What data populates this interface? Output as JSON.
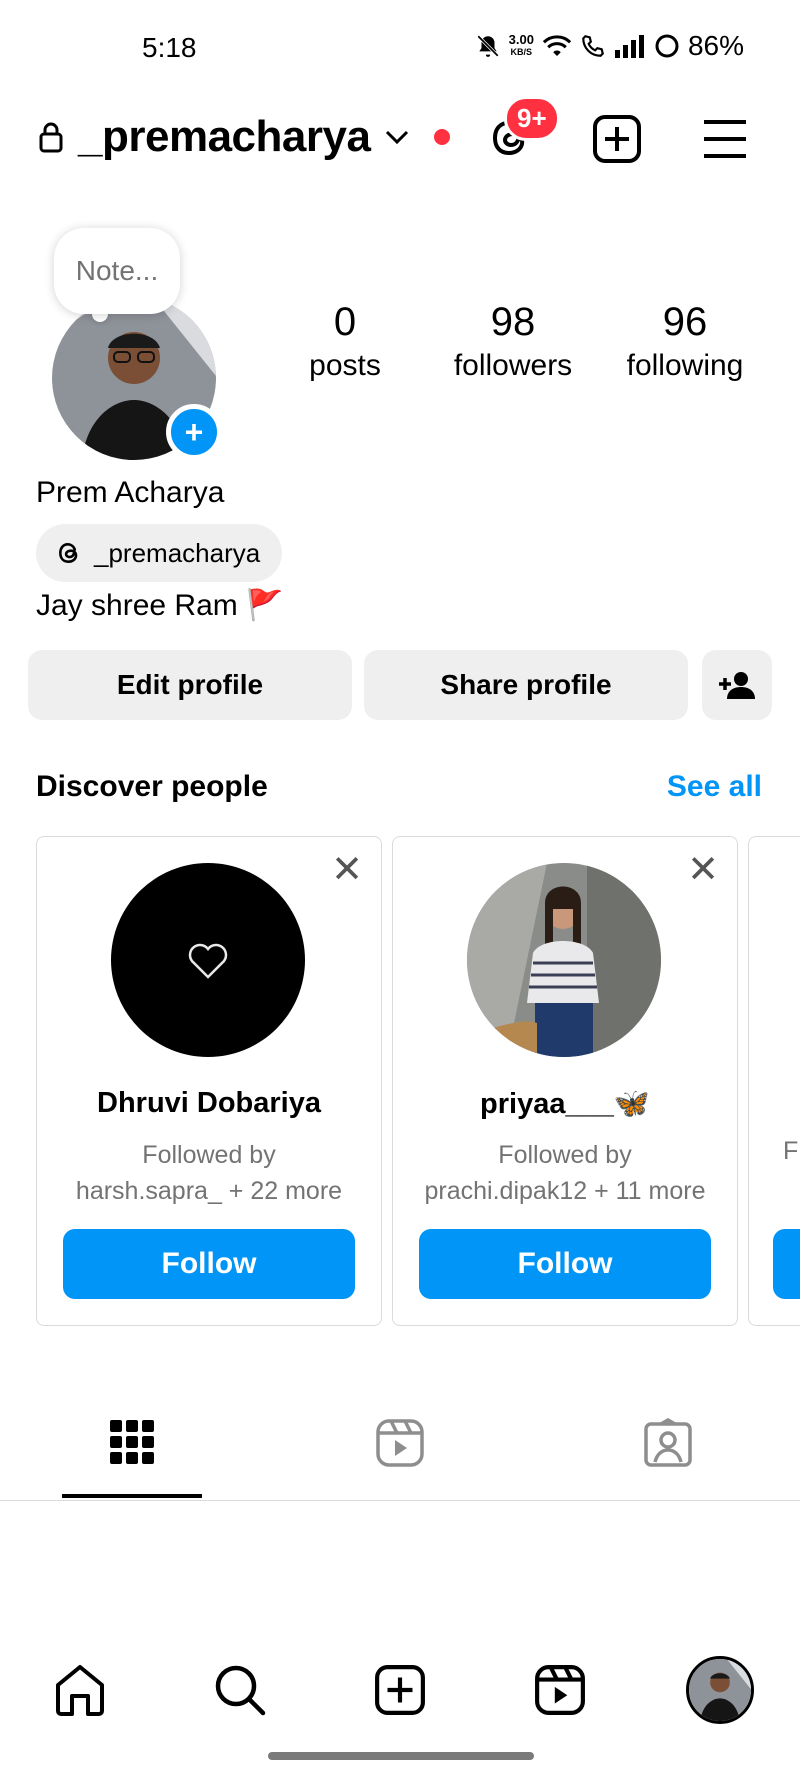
{
  "status_bar": {
    "time": "5:18",
    "net_speed_value": "3.00",
    "net_speed_unit": "KB/S",
    "battery": "86%"
  },
  "header": {
    "username": "_premacharya",
    "threads_badge": "9+"
  },
  "profile": {
    "note_placeholder": "Note...",
    "full_name": "Prem Acharya",
    "threads_handle": "_premacharya",
    "bio": "Jay shree Ram 🚩",
    "stats": [
      {
        "value": "0",
        "label": "posts"
      },
      {
        "value": "98",
        "label": "followers"
      },
      {
        "value": "96",
        "label": "following"
      }
    ]
  },
  "actions": {
    "edit_profile": "Edit profile",
    "share_profile": "Share profile"
  },
  "discover": {
    "title": "Discover people",
    "see_all": "See all",
    "cards": [
      {
        "name": "Dhruvi Dobariya",
        "followed_by_label": "Followed by",
        "followed_by": "harsh.sapra_ + 22 more",
        "button": "Follow"
      },
      {
        "name": "priyaa___🦋",
        "followed_by_label": "Followed by",
        "followed_by": "prachi.dipak12 + 11 more",
        "button": "Follow"
      }
    ],
    "partial_card_text": "F"
  },
  "colors": {
    "accent": "#0095f6",
    "badge_red": "#ff3040",
    "button_grey": "#efefef"
  }
}
